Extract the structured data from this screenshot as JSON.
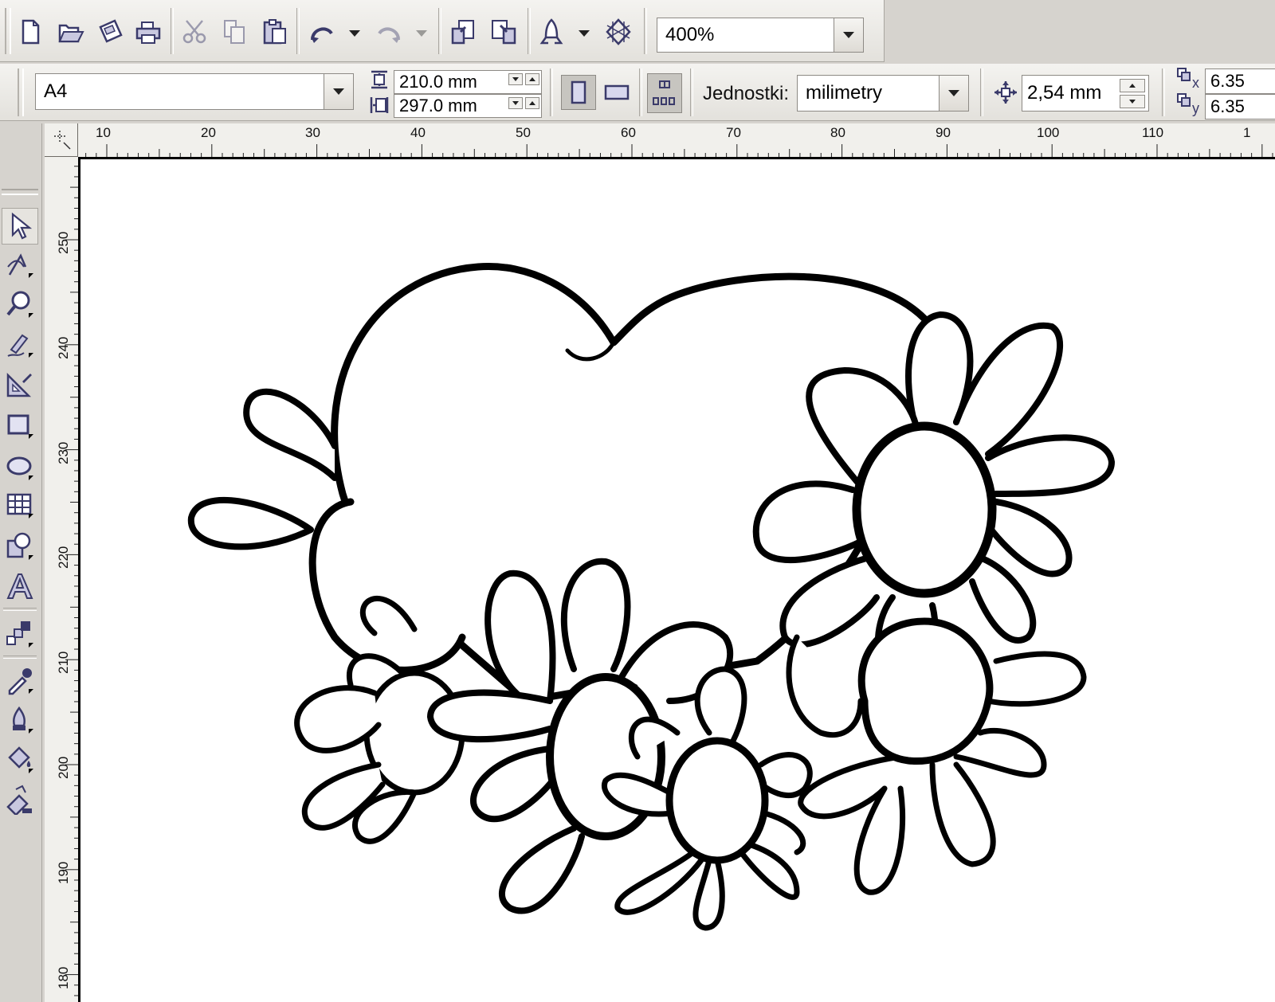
{
  "standard_toolbar": {
    "zoom_value": "400%",
    "buttons": [
      "new-icon",
      "open-icon",
      "save-icon",
      "print-icon",
      "cut-icon",
      "copy-icon",
      "paste-icon",
      "undo-icon",
      "redo-icon",
      "import-icon",
      "export-icon",
      "application-launcher-icon",
      "welcome-screen-icon"
    ]
  },
  "property_bar": {
    "paper_type": "A4",
    "page_width": "210.0 mm",
    "page_height": "297.0 mm",
    "units_label": "Jednostki:",
    "units_value": "milimetry",
    "nudge_distance": "2,54 mm",
    "duplicate_x": "6.35",
    "duplicate_y": "6.35",
    "dup_x_axis": "x",
    "dup_y_axis": "y"
  },
  "toolbox": {
    "tools": [
      "pick-tool-icon",
      "shape-tool-icon",
      "zoom-tool-icon",
      "freehand-tool-icon",
      "smart-fill-tool-icon",
      "rectangle-tool-icon",
      "ellipse-tool-icon",
      "table-tool-icon",
      "basic-shapes-tool-icon",
      "text-tool-icon",
      "interactive-blend-tool-icon",
      "eyedropper-tool-icon",
      "outline-tool-icon",
      "fill-tool-icon",
      "interactive-fill-tool-icon"
    ]
  },
  "rulers": {
    "horizontal_labels": [
      "10",
      "20",
      "30",
      "40",
      "50",
      "60",
      "70",
      "80",
      "90",
      "100",
      "110",
      "1"
    ],
    "vertical_labels": [
      "250",
      "240",
      "230",
      "220",
      "210",
      "200",
      "190",
      "180"
    ]
  },
  "colors": {
    "chrome": "#d6d3ce",
    "icon": "#3a3a6a",
    "canvas": "#ffffff",
    "outline": "#000000"
  }
}
